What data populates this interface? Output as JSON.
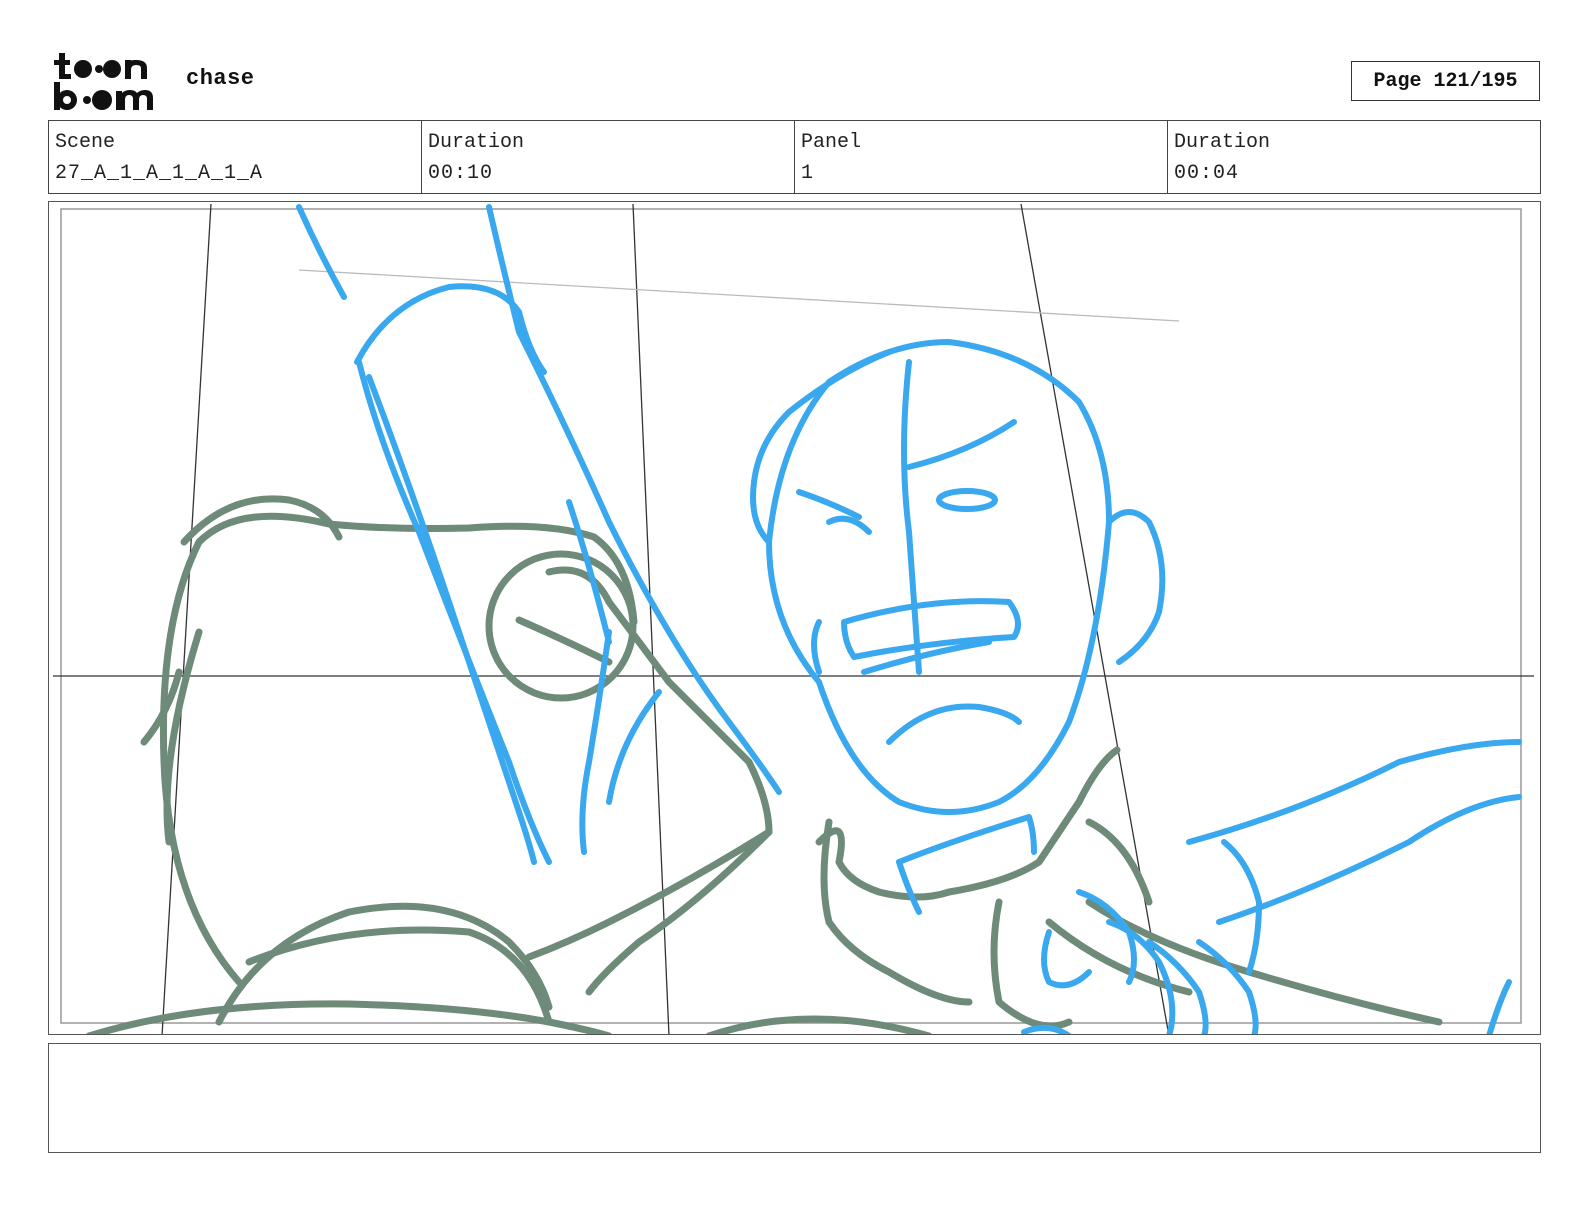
{
  "header": {
    "logo_text": "toonboom",
    "project_title": "chase",
    "page_label": "Page 121/195"
  },
  "info": {
    "scene_label": "Scene",
    "scene_value": "27_A_1_A_1_A_1_A",
    "scene_duration_label": "Duration",
    "scene_duration_value": "00:10",
    "panel_label": "Panel",
    "panel_value": "1",
    "panel_duration_label": "Duration",
    "panel_duration_value": "00:04"
  },
  "colors": {
    "sketch_blue": "#3aa8ee",
    "sketch_green": "#6e8a78",
    "grid_line": "#333333"
  },
  "notes": {
    "text": ""
  }
}
